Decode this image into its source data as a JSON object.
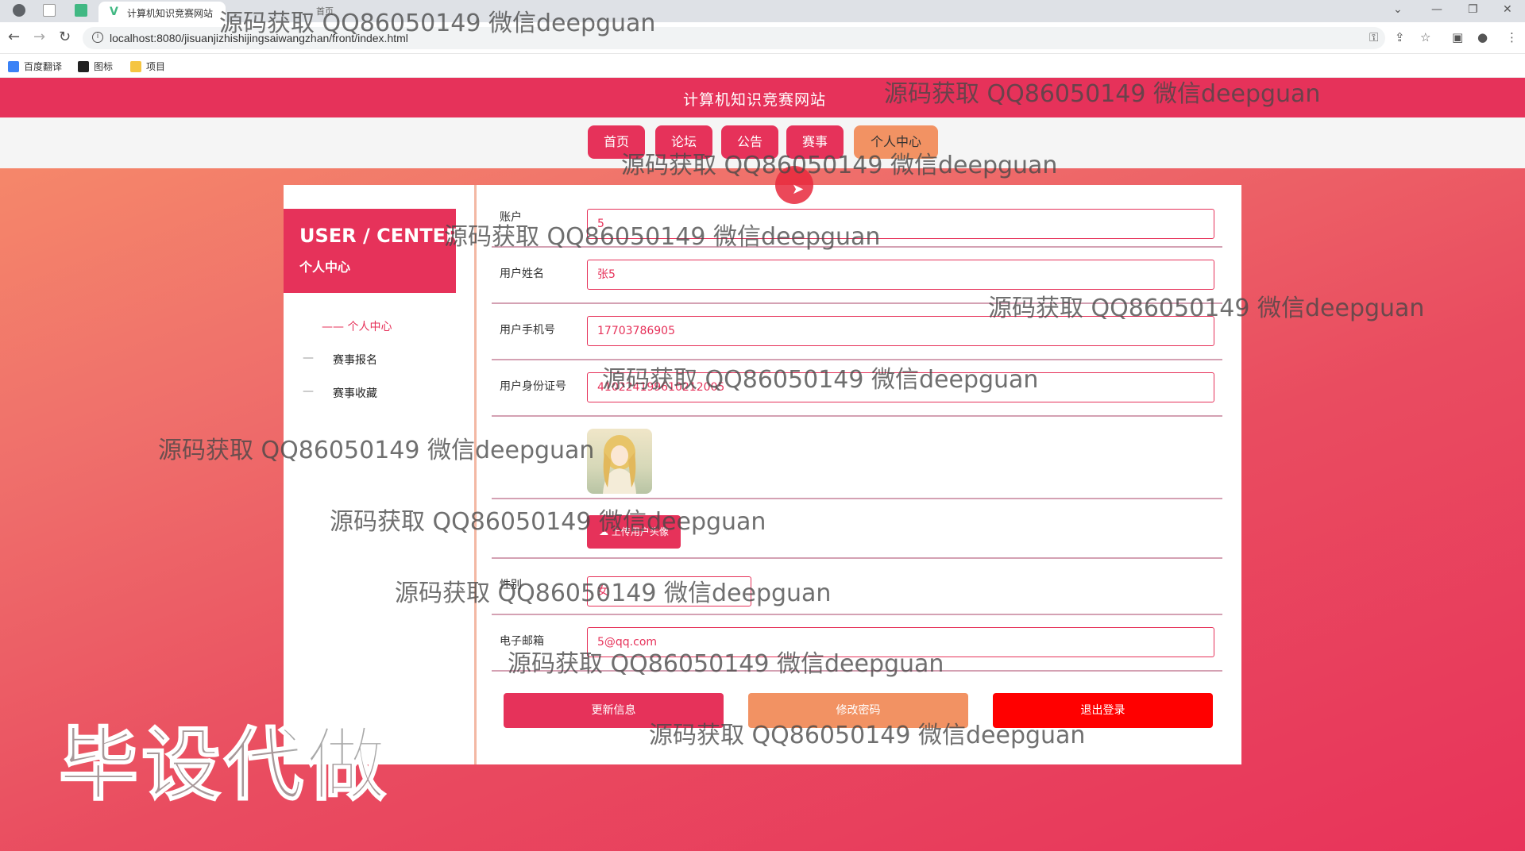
{
  "browser": {
    "tab_title": "计算机知识竞赛网站",
    "tab_title_2": "首页",
    "url": "localhost:8080/jisuanjizhishijingsaiwangzhan/front/index.html",
    "bookmarks": [
      "百度翻译",
      "图标",
      "项目"
    ]
  },
  "site": {
    "title": "计算机知识竞赛网站",
    "nav": [
      "首页",
      "论坛",
      "公告",
      "赛事",
      "个人中心"
    ],
    "active_nav": "个人中心"
  },
  "sidebar": {
    "heading_en": "USER / CENTER",
    "heading_cn": "个人中心",
    "links": [
      {
        "label": "—— 个人中心",
        "active": true
      },
      {
        "label": "赛事报名",
        "prefix": "—",
        "active": false
      },
      {
        "label": "赛事收藏",
        "prefix": "—",
        "active": false
      }
    ]
  },
  "form": {
    "account_label": "账户",
    "account_value": "5",
    "name_label": "用户姓名",
    "name_value": "张5",
    "phone_label": "用户手机号",
    "phone_value": "17703786905",
    "idcard_label": "用户身份证号",
    "idcard_value": "410224199610212005",
    "upload_label": "上传用户头像",
    "gender_label": "性别",
    "gender_value": "女",
    "email_label": "电子邮箱",
    "email_value": "5@qq.com"
  },
  "actions": {
    "update": "更新信息",
    "change_password": "修改密码",
    "logout": "退出登录"
  },
  "watermarks": {
    "text": "源码获取 QQ86050149 微信deepguan",
    "big": "毕设代做"
  },
  "colors": {
    "primary": "#e6325a",
    "accent": "#f29263",
    "logout": "#ff0000"
  }
}
